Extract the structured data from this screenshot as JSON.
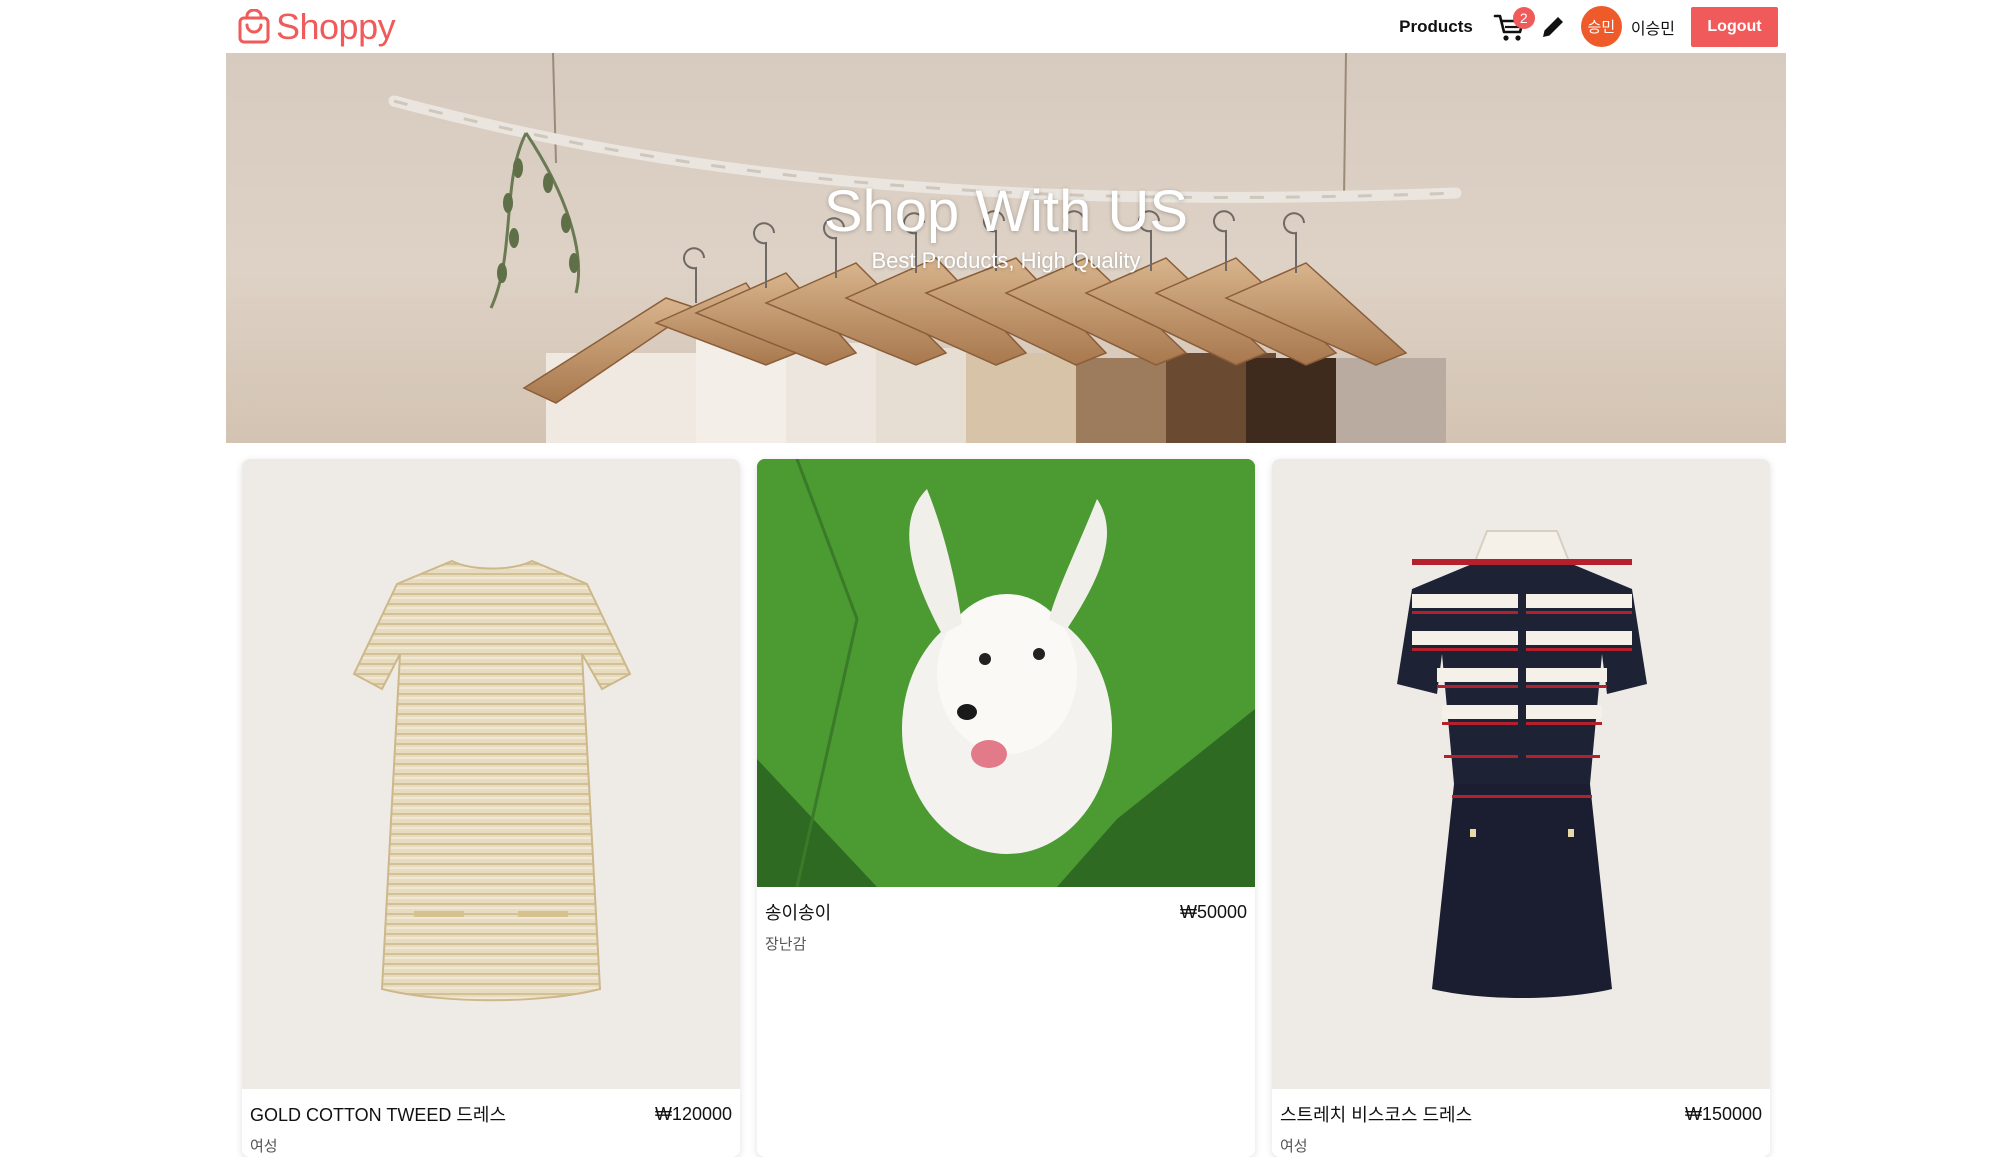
{
  "brand": {
    "name": "Shoppy",
    "icon": "shopping-bag-icon"
  },
  "nav": {
    "products_label": "Products",
    "cart_count": "2",
    "avatar_text": "승민",
    "user_name": "이승민",
    "logout_label": "Logout"
  },
  "banner": {
    "title": "Shop With US",
    "subtitle": "Best Products, High Quality"
  },
  "products": [
    {
      "title": "GOLD COTTON TWEED 드레스",
      "price": "₩120000",
      "category": "여성"
    },
    {
      "title": "송이송이",
      "price": "₩50000",
      "category": "장난감"
    },
    {
      "title": "스트레치 비스코스 드레스",
      "price": "₩150000",
      "category": "여성"
    }
  ],
  "colors": {
    "accent": "#f05a5a",
    "avatar": "#ee5a2a"
  }
}
